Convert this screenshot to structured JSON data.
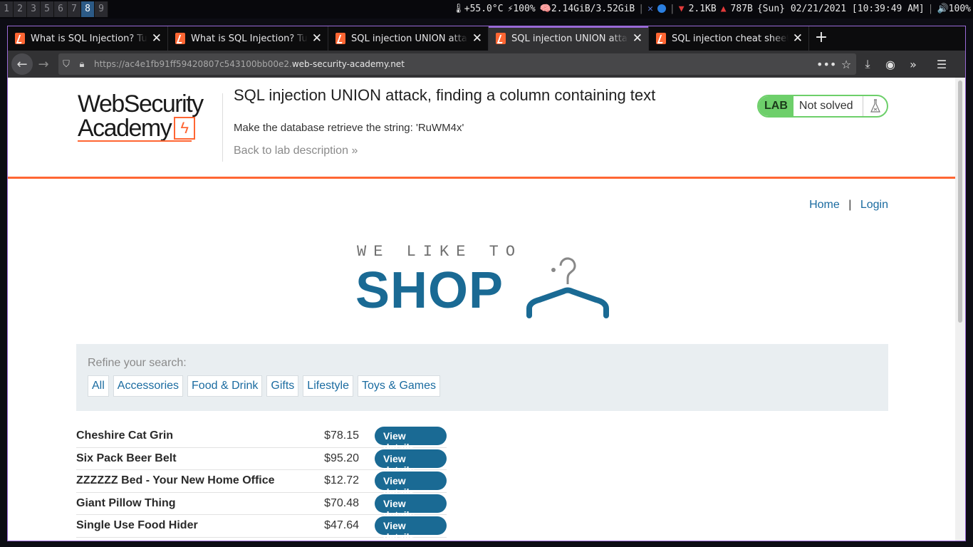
{
  "statusbar": {
    "workspaces": [
      "1",
      "2",
      "3",
      "5",
      "6",
      "7",
      "8",
      "9"
    ],
    "active_workspace": "8",
    "temperature": "🌡+55.0°C",
    "battery": "⚡100%",
    "memory": "🧠2.14GiB/3.52GiB",
    "net_down": "2.1KB",
    "net_up": "787B",
    "datetime": "{Sun} 02/21/2021 [10:39:49 AM]",
    "volume": "🔊100%"
  },
  "tabs": [
    {
      "title": "What is SQL Injection? Tutorial",
      "active": false
    },
    {
      "title": "What is SQL Injection? Tutorial",
      "active": false
    },
    {
      "title": "SQL injection UNION attacks",
      "active": false
    },
    {
      "title": "SQL injection UNION attack, f",
      "active": true
    },
    {
      "title": "SQL injection cheat sheet | Web",
      "active": false
    }
  ],
  "url": {
    "prefix": "https://ac4e1fb91ff59420807c543100bb00e2.",
    "domain": "web-security-academy.net"
  },
  "lab": {
    "logo_line1": "WebSecurity",
    "logo_line2": "Academy",
    "title": "SQL injection UNION attack, finding a column containing text",
    "task": "Make the database retrieve the string: 'RuWM4x'",
    "back_link": "Back to lab description",
    "badge": "LAB",
    "state": "Not solved"
  },
  "nav": {
    "home": "Home",
    "separator": "|",
    "login": "Login"
  },
  "shop": {
    "tagline": "WE LIKE TO",
    "word": "SHOP"
  },
  "refine": {
    "label": "Refine your search:",
    "filters": [
      "All",
      "Accessories",
      "Food & Drink",
      "Gifts",
      "Lifestyle",
      "Toys & Games"
    ]
  },
  "products": [
    {
      "name": "Cheshire Cat Grin",
      "price": "$78.15",
      "button": "View details"
    },
    {
      "name": "Six Pack Beer Belt",
      "price": "$95.20",
      "button": "View details"
    },
    {
      "name": "ZZZZZZ Bed - Your New Home Office",
      "price": "$12.72",
      "button": "View details"
    },
    {
      "name": "Giant Pillow Thing",
      "price": "$70.48",
      "button": "View details"
    },
    {
      "name": "Single Use Food Hider",
      "price": "$47.64",
      "button": "View details"
    }
  ],
  "colors": {
    "accent": "#ff6633",
    "brand_blue": "#1a6a94",
    "lab_green": "#6dcf6a",
    "tab_highlight": "#9a6ad8"
  }
}
